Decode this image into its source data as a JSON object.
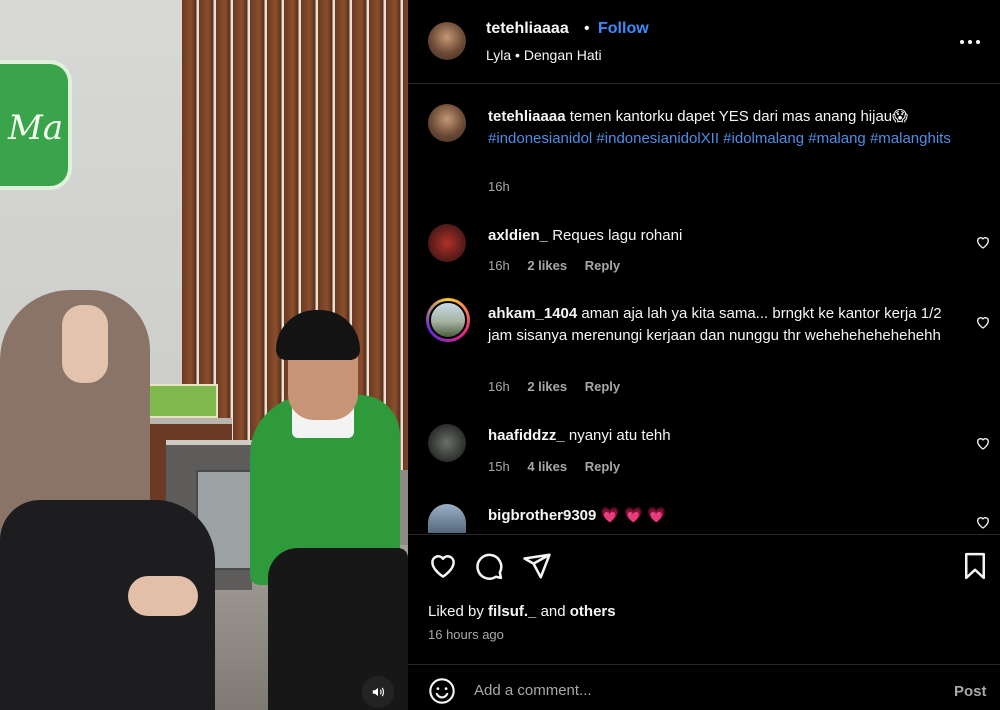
{
  "media": {
    "sign_text": "Ma",
    "sound_icon": "speaker-icon"
  },
  "header": {
    "username": "tetehliaaaa",
    "separator": "•",
    "follow_label": "Follow",
    "audio_label": "Lyla • Dengan Hati",
    "more_icon": "more-options-icon"
  },
  "caption": {
    "username": "tetehliaaaa",
    "text": "temen kantorku dapet YES dari mas anang hijau",
    "emoji": "😱",
    "hashtags": "#indonesianidol #indonesianidolXII #idolmalang #malang #malanghits",
    "time": "16h"
  },
  "comments": [
    {
      "username": "axldien_",
      "text": "Reques lagu rohani",
      "time": "16h",
      "likes": "2 likes",
      "reply": "Reply"
    },
    {
      "username": "ahkam_1404",
      "text": "aman aja lah ya kita sama... brngkt ke kantor kerja 1/2 jam sisanya merenungi kerjaan dan nunggu thr wehehehehehehehh",
      "time": "16h",
      "likes": "2 likes",
      "reply": "Reply"
    },
    {
      "username": "haafiddzz_",
      "text": "nyanyi atu tehh",
      "time": "15h",
      "likes": "4 likes",
      "reply": "Reply"
    },
    {
      "username": "bigbrother9309",
      "text": "💗 💗 💗"
    }
  ],
  "actions": {
    "like_icon": "heart-icon",
    "comment_icon": "comment-icon",
    "share_icon": "share-icon",
    "save_icon": "bookmark-icon",
    "liked_by_prefix": "Liked by",
    "liked_by_user": "filsuf._",
    "liked_by_and": "and",
    "liked_by_others": "others",
    "time_ago": "16 hours ago"
  },
  "composer": {
    "placeholder": "Add a comment...",
    "post_label": "Post",
    "emoji_icon": "emoji-icon"
  },
  "colors": {
    "background": "#000000",
    "link_blue": "#3f8af8",
    "hashtag_blue": "#4f8de6",
    "muted": "#a8a8a8",
    "text": "#f5f5f5"
  }
}
